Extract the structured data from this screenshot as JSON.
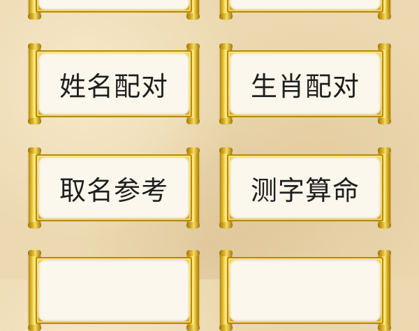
{
  "menu": {
    "row1": {
      "left": "",
      "right": ""
    },
    "row2": {
      "left": "姓名配对",
      "right": "生肖配对"
    },
    "row3": {
      "left": "取名参考",
      "right": "测字算命"
    },
    "row4": {
      "left": "",
      "right": ""
    }
  },
  "colors": {
    "background": "#ecd9b1",
    "scroll_gold": "#e9bd1e",
    "panel": "#fbf7ec",
    "label_text": "#1f1f1f"
  }
}
